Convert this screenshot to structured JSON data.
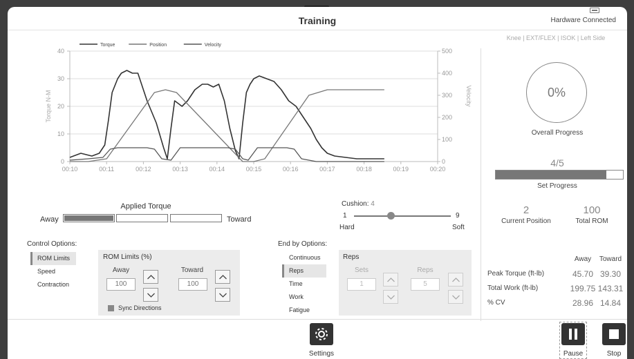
{
  "header": {
    "title": "Training",
    "status": "Hardware Connected"
  },
  "meta": "Knee | EXT/FLEX | ISOK | Left Side",
  "chart_data": {
    "type": "line",
    "x_ticks": [
      "00:10",
      "00:11",
      "00:12",
      "00:13",
      "00:14",
      "00:15",
      "00:16",
      "00:17",
      "00:18",
      "00:19",
      "00:20"
    ],
    "x_range": [
      10,
      20
    ],
    "ylabel_left": "Torque N-M",
    "ylim_left": [
      0,
      40
    ],
    "yticks_left": [
      0,
      10,
      20,
      30,
      40
    ],
    "ylabel_right": "Velocity",
    "ylim_right": [
      0,
      500
    ],
    "yticks_right": [
      0,
      100,
      200,
      300,
      400,
      500
    ],
    "legend": [
      "Torque",
      "Position",
      "Velocity"
    ],
    "grid": true,
    "series": [
      {
        "name": "Torque",
        "axis": "left",
        "color": "#333333",
        "x": [
          10.0,
          10.3,
          10.6,
          10.8,
          10.95,
          11.05,
          11.15,
          11.3,
          11.4,
          11.55,
          11.7,
          11.85,
          11.95,
          12.1,
          12.35,
          12.55,
          12.65,
          12.75,
          12.85,
          12.95,
          13.05,
          13.2,
          13.4,
          13.6,
          13.75,
          13.9,
          14.05,
          14.2,
          14.35,
          14.5,
          14.6,
          14.7,
          14.8,
          14.9,
          15.0,
          15.15,
          15.35,
          15.55,
          15.75,
          15.95,
          16.15,
          16.35,
          16.55,
          16.7,
          16.85,
          17.0,
          17.2,
          17.5,
          17.8,
          18.1,
          18.55
        ],
        "values": [
          1.5,
          3,
          2,
          3,
          6,
          15,
          25,
          30,
          32,
          33,
          32,
          32,
          28,
          22,
          14,
          5,
          1,
          12,
          22,
          21,
          20,
          22,
          26,
          28,
          28,
          27,
          28,
          22,
          12,
          4,
          1,
          14,
          25,
          28,
          30,
          31,
          30,
          29,
          26,
          22,
          20,
          16,
          12,
          8,
          5,
          3,
          2,
          1.5,
          1,
          1,
          1
        ]
      },
      {
        "name": "Position",
        "axis": "left",
        "color": "#777777",
        "x": [
          10.0,
          10.5,
          11.0,
          12.3,
          12.6,
          12.9,
          14.7,
          15.0,
          15.3,
          16.5,
          17.0,
          18.55
        ],
        "values": [
          0,
          0,
          1,
          25,
          26,
          25,
          0,
          0,
          1,
          24,
          26,
          26
        ]
      },
      {
        "name": "Velocity",
        "axis": "left",
        "color": "#555555",
        "x": [
          10.0,
          10.5,
          10.9,
          11.1,
          11.3,
          12.1,
          12.3,
          12.5,
          12.75,
          13.0,
          14.3,
          14.5,
          14.7,
          14.85,
          15.1,
          15.9,
          16.1,
          16.3,
          16.5,
          16.7,
          18.55
        ],
        "values": [
          0.5,
          1,
          1.5,
          4.5,
          5,
          5,
          4.5,
          1,
          0.5,
          5,
          5,
          4.5,
          1,
          0.5,
          5,
          5,
          4.5,
          1,
          0.5,
          0,
          0
        ]
      }
    ]
  },
  "stats": {
    "overall_percent": "0%",
    "overall_label": "Overall Progress",
    "set_count": "4/5",
    "set_progress": 0.87,
    "set_label": "Set Progress",
    "current_position": "2",
    "current_position_label": "Current Position",
    "total_rom": "100",
    "total_rom_label": "Total ROM"
  },
  "results": {
    "col_away": "Away",
    "col_toward": "Toward",
    "rows": [
      {
        "label": "Peak Torque (ft-lb)",
        "away": "45.70",
        "toward": "39.30"
      },
      {
        "label": "Total Work (ft-lb)",
        "away": "199.75",
        "toward": "143.31"
      },
      {
        "label": "% CV",
        "away": "28.96",
        "toward": "14.84"
      }
    ]
  },
  "applied_torque": {
    "label": "Applied Torque",
    "away": "Away",
    "toward": "Toward"
  },
  "cushion": {
    "label": "Cushion:",
    "value": "4",
    "min": "1",
    "max": "9",
    "min_label": "Hard",
    "max_label": "Soft"
  },
  "control_options": {
    "label": "Control Options:",
    "items": [
      "ROM Limits",
      "Speed",
      "Contraction"
    ],
    "selected": 0
  },
  "rom_limits": {
    "title": "ROM Limits (%)",
    "away_label": "Away",
    "away_value": "100",
    "toward_label": "Toward",
    "toward_value": "100",
    "sync_label": "Sync Directions"
  },
  "end_by": {
    "label": "End by Options:",
    "items": [
      "Continuous",
      "Reps",
      "Time",
      "Work",
      "Fatigue"
    ],
    "selected": 1
  },
  "reps_panel": {
    "title": "Reps",
    "sets_label": "Sets",
    "sets_value": "1",
    "reps_label": "Reps",
    "reps_value": "5"
  },
  "footer": {
    "settings_label": "Settings",
    "pause_label": "Pause",
    "stop_label": "Stop"
  }
}
